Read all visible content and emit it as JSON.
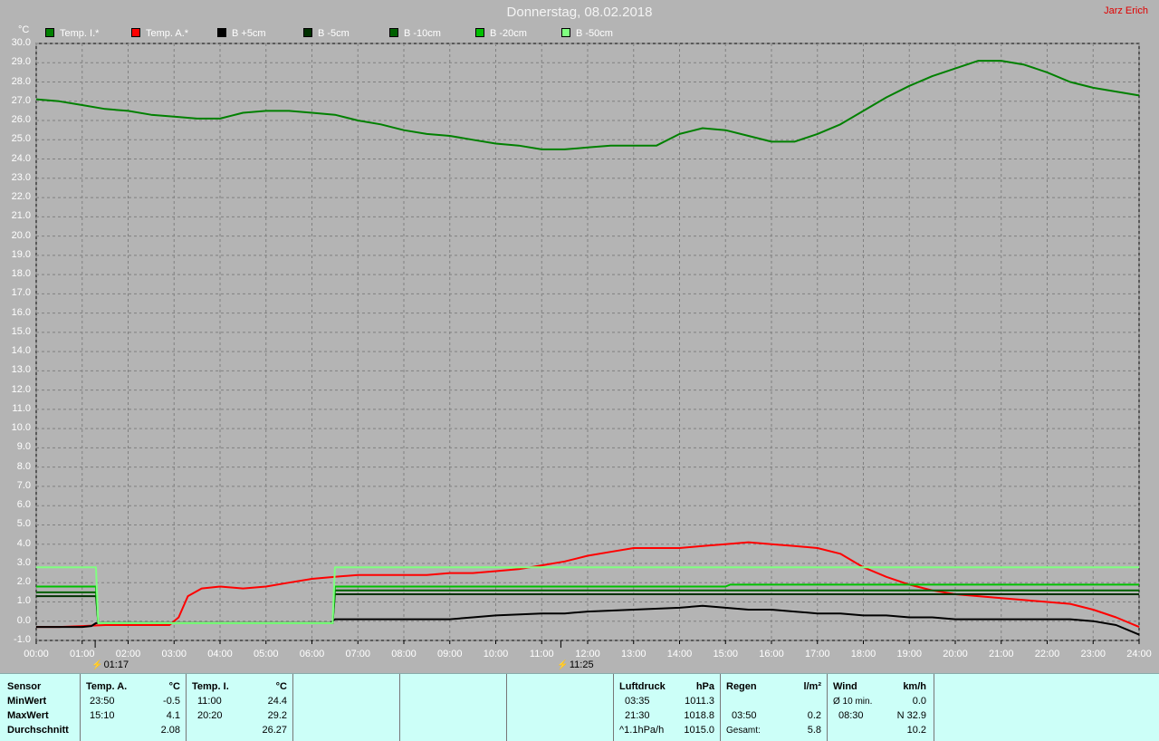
{
  "header": {
    "title": "Donnerstag, 08.02.2018",
    "author": "Jarz Erich",
    "unit": "°C"
  },
  "colors": {
    "background": "#b4b4b4",
    "grid": "#808080",
    "axis_text": "#ffffff",
    "panel_bg": "#ccfff8"
  },
  "chart_data": {
    "type": "line",
    "ylim": [
      -1.0,
      30.0
    ],
    "xlim": [
      0,
      24
    ],
    "yticks": [
      "30.0",
      "29.0",
      "28.0",
      "27.0",
      "26.0",
      "25.0",
      "24.0",
      "23.0",
      "22.0",
      "21.0",
      "20.0",
      "19.0",
      "18.0",
      "17.0",
      "16.0",
      "15.0",
      "14.0",
      "13.0",
      "12.0",
      "11.0",
      "10.0",
      "9.0",
      "8.0",
      "7.0",
      "6.0",
      "5.0",
      "4.0",
      "3.0",
      "2.0",
      "1.0",
      "0.0",
      "-1.0"
    ],
    "xticks": [
      "00:00",
      "01:00",
      "02:00",
      "03:00",
      "04:00",
      "05:00",
      "06:00",
      "07:00",
      "08:00",
      "09:00",
      "10:00",
      "11:00",
      "12:00",
      "13:00",
      "14:00",
      "15:00",
      "16:00",
      "17:00",
      "18:00",
      "19:00",
      "20:00",
      "21:00",
      "22:00",
      "23:00",
      "24:00"
    ],
    "grid": true,
    "legend_position": "top",
    "series": [
      {
        "name": "Temp. I.*",
        "color": "#008000",
        "x": [
          0,
          0.5,
          1,
          1.5,
          2,
          2.5,
          3,
          3.5,
          4,
          4.5,
          5,
          5.5,
          6,
          6.5,
          7,
          7.5,
          8,
          8.5,
          9,
          9.5,
          10,
          10.5,
          11,
          11.5,
          12,
          12.5,
          13,
          13.5,
          14,
          14.5,
          15,
          15.5,
          16,
          16.5,
          17,
          17.5,
          18,
          18.5,
          19,
          19.5,
          20,
          20.5,
          21,
          21.5,
          22,
          22.5,
          23,
          23.5,
          24
        ],
        "y": [
          27.1,
          27.0,
          26.8,
          26.6,
          26.5,
          26.3,
          26.2,
          26.1,
          26.1,
          26.4,
          26.5,
          26.5,
          26.4,
          26.3,
          26.0,
          25.8,
          25.5,
          25.3,
          25.2,
          25.0,
          24.8,
          24.7,
          24.5,
          24.5,
          24.6,
          24.7,
          24.7,
          24.7,
          25.3,
          25.6,
          25.5,
          25.2,
          24.9,
          24.9,
          25.3,
          25.8,
          26.5,
          27.2,
          27.8,
          28.3,
          28.7,
          29.1,
          29.1,
          28.9,
          28.5,
          28.0,
          27.7,
          27.5,
          27.3
        ]
      },
      {
        "name": "Temp. A.*",
        "color": "#ff0000",
        "x": [
          0,
          0.5,
          1,
          1.5,
          2,
          2.5,
          2.9,
          3.1,
          3.3,
          3.6,
          4,
          4.5,
          5,
          5.5,
          6,
          6.5,
          7,
          7.5,
          8,
          8.5,
          9,
          9.5,
          10,
          10.5,
          11,
          11.5,
          12,
          12.5,
          13,
          13.5,
          14,
          14.5,
          15,
          15.5,
          16,
          16.5,
          17,
          17.5,
          18,
          18.5,
          19,
          19.5,
          20,
          20.5,
          21,
          21.5,
          22,
          22.5,
          23,
          23.5,
          24
        ],
        "y": [
          -0.3,
          -0.3,
          -0.25,
          -0.2,
          -0.2,
          -0.2,
          -0.2,
          0.2,
          1.3,
          1.7,
          1.8,
          1.7,
          1.8,
          2.0,
          2.2,
          2.3,
          2.4,
          2.4,
          2.4,
          2.4,
          2.5,
          2.5,
          2.6,
          2.7,
          2.9,
          3.1,
          3.4,
          3.6,
          3.8,
          3.8,
          3.8,
          3.9,
          4.0,
          4.1,
          4.0,
          3.9,
          3.8,
          3.5,
          2.8,
          2.3,
          1.9,
          1.6,
          1.4,
          1.3,
          1.2,
          1.1,
          1.0,
          0.9,
          0.6,
          0.2,
          -0.3
        ]
      },
      {
        "name": "B +5cm",
        "color": "#000000",
        "x": [
          0,
          0.5,
          1,
          1.2,
          1.3,
          2,
          3,
          4,
          5,
          6,
          6.4,
          6.5,
          7,
          8,
          9,
          9.5,
          10,
          11,
          11.5,
          12,
          13,
          14,
          14.5,
          15,
          15.5,
          16,
          16.5,
          17,
          17.5,
          18,
          18.5,
          19,
          19.5,
          20,
          21,
          22,
          22.5,
          23,
          23.5,
          24
        ],
        "y": [
          -0.3,
          -0.3,
          -0.3,
          -0.25,
          -0.1,
          -0.1,
          -0.1,
          -0.1,
          -0.1,
          -0.1,
          -0.1,
          0.1,
          0.1,
          0.1,
          0.1,
          0.2,
          0.3,
          0.4,
          0.4,
          0.5,
          0.6,
          0.7,
          0.8,
          0.7,
          0.6,
          0.6,
          0.5,
          0.4,
          0.4,
          0.3,
          0.3,
          0.2,
          0.2,
          0.1,
          0.1,
          0.1,
          0.1,
          0.0,
          -0.2,
          -0.7
        ]
      },
      {
        "name": "B -5cm",
        "color": "#003000",
        "x": [
          0,
          1.3,
          1.35,
          6.45,
          6.5,
          24
        ],
        "y": [
          1.3,
          1.3,
          -0.1,
          -0.1,
          1.4,
          1.4
        ]
      },
      {
        "name": "B -10cm",
        "color": "#006000",
        "x": [
          0,
          1.3,
          1.35,
          6.45,
          6.5,
          24
        ],
        "y": [
          1.5,
          1.5,
          -0.1,
          -0.1,
          1.6,
          1.6
        ]
      },
      {
        "name": "B -20cm",
        "color": "#00c000",
        "x": [
          0,
          1.3,
          1.35,
          6.45,
          6.5,
          15.0,
          15.1,
          24
        ],
        "y": [
          1.8,
          1.8,
          -0.1,
          -0.1,
          1.8,
          1.8,
          1.9,
          1.9
        ]
      },
      {
        "name": "B -50cm",
        "color": "#80ff80",
        "x": [
          0,
          1.3,
          1.35,
          6.45,
          6.5,
          24
        ],
        "y": [
          2.8,
          2.8,
          -0.1,
          -0.1,
          2.8,
          2.8
        ]
      }
    ],
    "markers": [
      {
        "label": "01:17",
        "x": 1.283
      },
      {
        "label": "11:25",
        "x": 11.417
      }
    ]
  },
  "table": {
    "sensor": {
      "h": "Sensor",
      "r1": "MinWert",
      "r2": "MaxWert",
      "r3": "Durchschnitt"
    },
    "temp_a": {
      "h": "Temp. A.",
      "unit": "°C",
      "t1": "23:50",
      "v1": "-0.5",
      "t2": "15:10",
      "v2": "4.1",
      "v3": "2.08"
    },
    "temp_i": {
      "h": "Temp. I.",
      "unit": "°C",
      "t1": "11:00",
      "v1": "24.4",
      "t2": "20:20",
      "v2": "29.2",
      "v3": "26.27"
    },
    "pressure": {
      "h": "Luftdruck",
      "unit": "hPa",
      "t1": "03:35",
      "v1": "1011.3",
      "t2": "21:30",
      "v2": "1018.8",
      "t3": "^1.1hPa/h",
      "v3": "1015.0"
    },
    "rain": {
      "h": "Regen",
      "unit": "l/m²",
      "t2": "03:50",
      "v2": "0.2",
      "t3": "Gesamt:",
      "v3": "5.8"
    },
    "wind": {
      "h": "Wind",
      "unit": "km/h",
      "t1": "Ø 10 min.",
      "v1": "0.0",
      "t2": "08:30",
      "v2": "N 32.9",
      "v3": "10.2"
    }
  }
}
